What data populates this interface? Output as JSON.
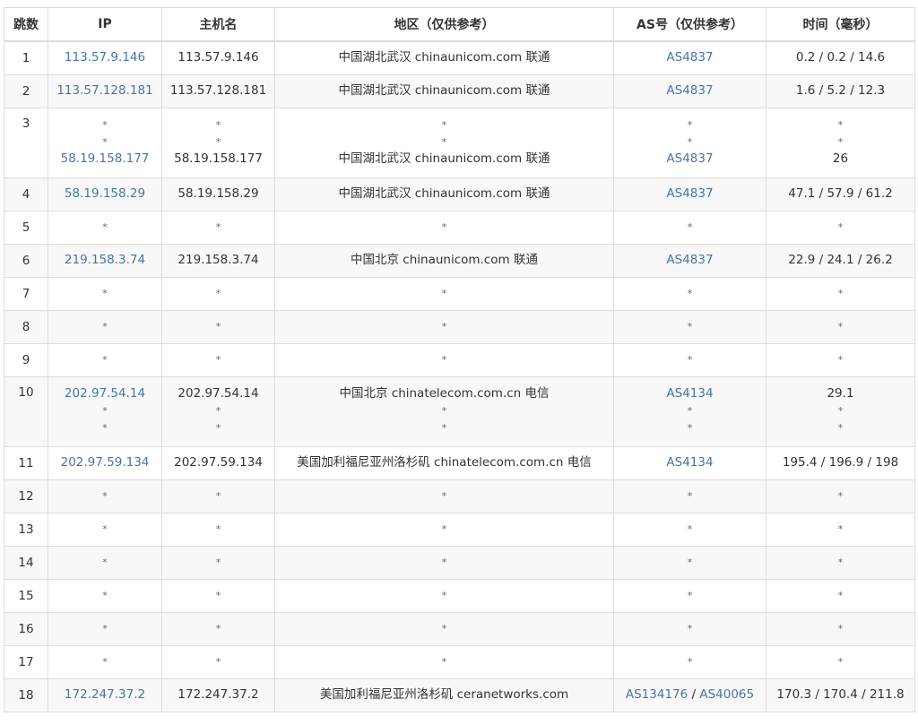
{
  "headers": [
    "跳数",
    "IP",
    "主机名",
    "地区（仅供参考）",
    "AS号（仅供参考）",
    "时间（毫秒）"
  ],
  "rows": [
    {
      "hop": "1",
      "ip": [
        "113.57.9.146"
      ],
      "host": [
        "113.57.9.146"
      ],
      "region": [
        "中国湖北武汉 chinaunicom.com 联通"
      ],
      "asn": [
        [
          "AS4837"
        ]
      ],
      "time": [
        "0.2 / 0.2 / 14.6"
      ]
    },
    {
      "hop": "2",
      "ip": [
        "113.57.128.181"
      ],
      "host": [
        "113.57.128.181"
      ],
      "region": [
        "中国湖北武汉 chinaunicom.com 联通"
      ],
      "asn": [
        [
          "AS4837"
        ]
      ],
      "time": [
        "1.6 / 5.2 / 12.3"
      ]
    },
    {
      "hop": "3",
      "ip": [
        "*",
        "*",
        "58.19.158.177"
      ],
      "host": [
        "*",
        "*",
        "58.19.158.177"
      ],
      "region": [
        "*",
        "*",
        "中国湖北武汉 chinaunicom.com 联通"
      ],
      "asn": [
        [
          "*"
        ],
        [
          "*"
        ],
        [
          "AS4837"
        ]
      ],
      "time": [
        "*",
        "*",
        "26"
      ]
    },
    {
      "hop": "4",
      "ip": [
        "58.19.158.29"
      ],
      "host": [
        "58.19.158.29"
      ],
      "region": [
        "中国湖北武汉 chinaunicom.com 联通"
      ],
      "asn": [
        [
          "AS4837"
        ]
      ],
      "time": [
        "47.1 / 57.9 / 61.2"
      ]
    },
    {
      "hop": "5",
      "ip": [
        "*"
      ],
      "host": [
        "*"
      ],
      "region": [
        "*"
      ],
      "asn": [
        [
          "*"
        ]
      ],
      "time": [
        "*"
      ]
    },
    {
      "hop": "6",
      "ip": [
        "219.158.3.74"
      ],
      "host": [
        "219.158.3.74"
      ],
      "region": [
        "中国北京 chinaunicom.com 联通"
      ],
      "asn": [
        [
          "AS4837"
        ]
      ],
      "time": [
        "22.9 / 24.1 / 26.2"
      ]
    },
    {
      "hop": "7",
      "ip": [
        "*"
      ],
      "host": [
        "*"
      ],
      "region": [
        "*"
      ],
      "asn": [
        [
          "*"
        ]
      ],
      "time": [
        "*"
      ]
    },
    {
      "hop": "8",
      "ip": [
        "*"
      ],
      "host": [
        "*"
      ],
      "region": [
        "*"
      ],
      "asn": [
        [
          "*"
        ]
      ],
      "time": [
        "*"
      ]
    },
    {
      "hop": "9",
      "ip": [
        "*"
      ],
      "host": [
        "*"
      ],
      "region": [
        "*"
      ],
      "asn": [
        [
          "*"
        ]
      ],
      "time": [
        "*"
      ]
    },
    {
      "hop": "10",
      "ip": [
        "202.97.54.14",
        "*",
        "*"
      ],
      "host": [
        "202.97.54.14",
        "*",
        "*"
      ],
      "region": [
        "中国北京 chinatelecom.com.cn 电信",
        "*",
        "*"
      ],
      "asn": [
        [
          "AS4134"
        ],
        [
          "*"
        ],
        [
          "*"
        ]
      ],
      "time": [
        "29.1",
        "*",
        "*"
      ]
    },
    {
      "hop": "11",
      "ip": [
        "202.97.59.134"
      ],
      "host": [
        "202.97.59.134"
      ],
      "region": [
        "美国加利福尼亚州洛杉矶 chinatelecom.com.cn 电信"
      ],
      "asn": [
        [
          "AS4134"
        ]
      ],
      "time": [
        "195.4 / 196.9 / 198"
      ]
    },
    {
      "hop": "12",
      "ip": [
        "*"
      ],
      "host": [
        "*"
      ],
      "region": [
        "*"
      ],
      "asn": [
        [
          "*"
        ]
      ],
      "time": [
        "*"
      ]
    },
    {
      "hop": "13",
      "ip": [
        "*"
      ],
      "host": [
        "*"
      ],
      "region": [
        "*"
      ],
      "asn": [
        [
          "*"
        ]
      ],
      "time": [
        "*"
      ]
    },
    {
      "hop": "14",
      "ip": [
        "*"
      ],
      "host": [
        "*"
      ],
      "region": [
        "*"
      ],
      "asn": [
        [
          "*"
        ]
      ],
      "time": [
        "*"
      ]
    },
    {
      "hop": "15",
      "ip": [
        "*"
      ],
      "host": [
        "*"
      ],
      "region": [
        "*"
      ],
      "asn": [
        [
          "*"
        ]
      ],
      "time": [
        "*"
      ]
    },
    {
      "hop": "16",
      "ip": [
        "*"
      ],
      "host": [
        "*"
      ],
      "region": [
        "*"
      ],
      "asn": [
        [
          "*"
        ]
      ],
      "time": [
        "*"
      ]
    },
    {
      "hop": "17",
      "ip": [
        "*"
      ],
      "host": [
        "*"
      ],
      "region": [
        "*"
      ],
      "asn": [
        [
          "*"
        ]
      ],
      "time": [
        "*"
      ]
    },
    {
      "hop": "18",
      "ip": [
        "172.247.37.2"
      ],
      "host": [
        "172.247.37.2"
      ],
      "region": [
        "美国加利福尼亚州洛杉矶 ceranetworks.com"
      ],
      "asn": [
        [
          "AS134176",
          "AS40065"
        ]
      ],
      "time": [
        "170.3 / 170.4 / 211.8"
      ]
    }
  ],
  "asn_separator": " / ",
  "colors": {
    "link": "#4a73a8",
    "text": "#333333",
    "border": "#dddddd",
    "stripe": "#f8f8f8"
  }
}
